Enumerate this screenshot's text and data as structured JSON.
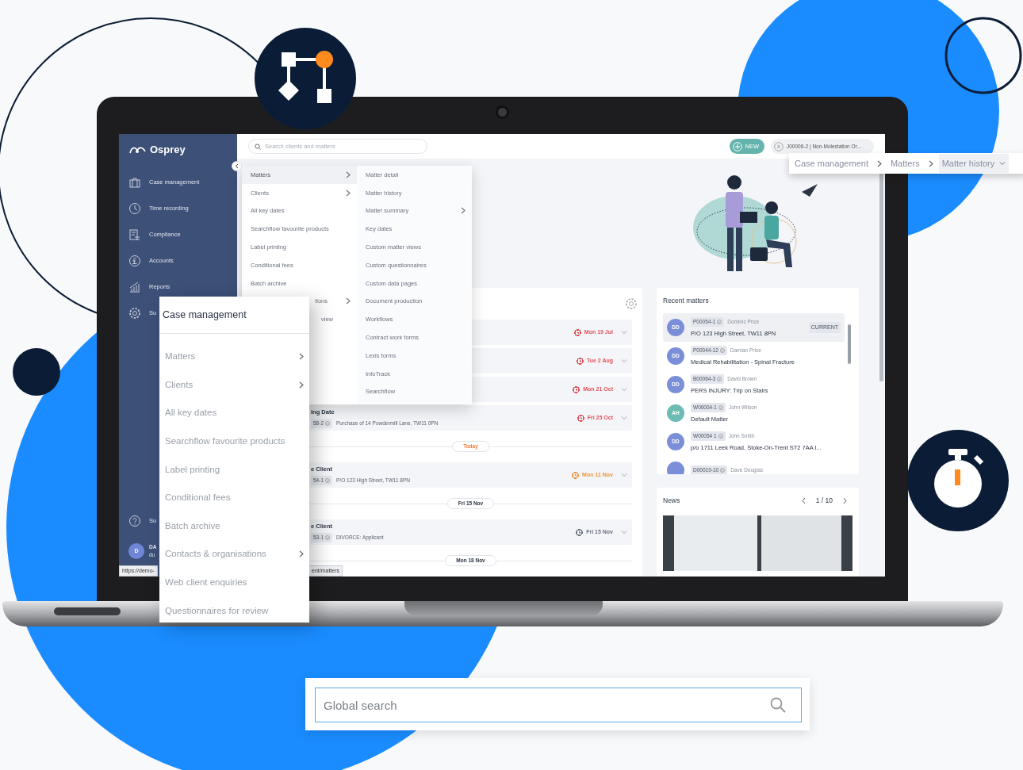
{
  "sidebar": {
    "logo": "Osprey",
    "items": [
      {
        "label": "Case management"
      },
      {
        "label": "Time recording"
      },
      {
        "label": "Compliance"
      },
      {
        "label": "Accounts"
      },
      {
        "label": "Reports"
      },
      {
        "label": "Su"
      }
    ],
    "help": "Su",
    "user": {
      "initials": "D",
      "name": "DA",
      "email": "du"
    }
  },
  "status_bar": [
    "https://demo-",
    "ent/matters"
  ],
  "topbar": {
    "search": {
      "placeholder": "Search clients and matters"
    },
    "new_button": "NEW",
    "recent_matter": "J00006-2 | Non-Molestation Or..."
  },
  "nav_menu": {
    "columns": [
      [
        {
          "label": "Matters",
          "submenu": true,
          "selected": true,
          "kind": "full"
        },
        {
          "label": "Clients",
          "submenu": true,
          "selected": false,
          "kind": "full"
        },
        {
          "label": "All key dates",
          "submenu": false,
          "selected": false,
          "kind": "full"
        },
        {
          "label": "Searchflow favourite products",
          "submenu": false,
          "selected": false,
          "kind": "full"
        },
        {
          "label": "Label printing",
          "submenu": false,
          "selected": false,
          "kind": "full"
        },
        {
          "label": "Conditional fees",
          "submenu": false,
          "selected": false,
          "kind": "full"
        },
        {
          "label": "Batch archive",
          "submenu": false,
          "selected": false,
          "kind": "full"
        },
        {
          "label": "tions",
          "submenu": true,
          "selected": false,
          "kind": "cut"
        },
        {
          "label": "view",
          "submenu": false,
          "selected": false,
          "kind": "cut"
        }
      ],
      [
        {
          "label": "Matter detail",
          "submenu": false,
          "selected": false,
          "kind": "full"
        },
        {
          "label": "Matter history",
          "submenu": false,
          "selected": false,
          "kind": "full"
        },
        {
          "label": "Matter summary",
          "submenu": true,
          "selected": false,
          "kind": "full"
        },
        {
          "label": "Key dates",
          "submenu": false,
          "selected": false,
          "kind": "full"
        },
        {
          "label": "Custom matter views",
          "submenu": false,
          "selected": false,
          "kind": "full"
        },
        {
          "label": "Custom questionnaires",
          "submenu": false,
          "selected": false,
          "kind": "full"
        },
        {
          "label": "Custom data pages",
          "submenu": false,
          "selected": false,
          "kind": "full"
        },
        {
          "label": "Document production",
          "submenu": false,
          "selected": false,
          "kind": "full"
        },
        {
          "label": "Workflows",
          "submenu": false,
          "selected": false,
          "kind": "full"
        },
        {
          "label": "Contract work forms",
          "submenu": false,
          "selected": false,
          "kind": "full"
        },
        {
          "label": "Lexis forms",
          "submenu": false,
          "selected": false,
          "kind": "full"
        },
        {
          "label": "InfoTrack",
          "submenu": false,
          "selected": false,
          "kind": "full"
        },
        {
          "label": "Searchflow",
          "submenu": false,
          "selected": false,
          "kind": "full"
        }
      ]
    ]
  },
  "key_dates": {
    "entries": [
      {
        "kind": "row",
        "date": "Mon 19 Jul",
        "color": "#e2525c"
      },
      {
        "kind": "row",
        "date": "Tue 2 Aug",
        "color": "#e2525c"
      },
      {
        "kind": "row",
        "date": "Mon 21 Oct",
        "color": "#e2525c"
      },
      {
        "kind": "row",
        "title": "ing Date",
        "ref": "58-2",
        "description": "Purchase of 14 Powdermill Lane, TW11 0PN",
        "date": "Fri 25 Oct",
        "color": "#e2525c"
      },
      {
        "kind": "divider",
        "label": "Today",
        "color": "#f07d3c"
      },
      {
        "kind": "row",
        "title": "e Client",
        "ref": "54-1",
        "description": "P/O 123 High Street, TW11 8PN",
        "date": "Mon 11 Nov",
        "color": "#f0943c"
      },
      {
        "kind": "divider",
        "label": "Fri 15 Nov",
        "color": "#2b3445"
      },
      {
        "kind": "row",
        "title": "e Client",
        "ref": "53-1",
        "description": "DIVORCE: Applicant",
        "date": "Fri 15 Nov",
        "color": "#6b7280"
      },
      {
        "kind": "divider",
        "label": "Mon 18 Nov",
        "color": "#2b3445"
      }
    ]
  },
  "recent_matters": {
    "title": "Recent matters",
    "items": [
      {
        "initials": "DD",
        "color": "#7b8ed8",
        "ref": "P00054-1",
        "client": "Dominic Price",
        "title": "P/O 123 High Street, TW11 8PN",
        "badge": "CURRENT",
        "selected": true
      },
      {
        "initials": "DD",
        "color": "#7b8ed8",
        "ref": "P00044-12",
        "client": "Damian Price",
        "title": "Medical Rehabilitation - Spinal Fracture",
        "selected": false
      },
      {
        "initials": "DD",
        "color": "#7b8ed8",
        "ref": "B00064-3",
        "client": "David Brown",
        "title": "PERS INJURY: Trip on Stairs",
        "selected": false
      },
      {
        "initials": "AH",
        "color": "#6bbcb3",
        "ref": "W00004-1",
        "client": "John Wilson",
        "title": "Default Matter",
        "selected": false
      },
      {
        "initials": "DD",
        "color": "#7b8ed8",
        "ref": "W00054 1",
        "client": "John Smith",
        "title": "p/o 1711 Leek Road, Stoke-On-Trent ST2 7AA I...",
        "selected": false
      },
      {
        "color": "#7b8ed8",
        "ref": "D00019-10",
        "client": "Dave Douglas",
        "selected": false
      }
    ]
  },
  "news": {
    "title": "News",
    "pager": "1 / 10"
  },
  "case_menu": {
    "title": "Case management",
    "items": [
      {
        "label": "Matters",
        "submenu": true
      },
      {
        "label": "Clients",
        "submenu": true
      },
      {
        "label": "All key dates",
        "submenu": false
      },
      {
        "label": "Searchflow favourite products",
        "submenu": false
      },
      {
        "label": "Label printing",
        "submenu": false
      },
      {
        "label": "Conditional fees",
        "submenu": false
      },
      {
        "label": "Batch archive",
        "submenu": false
      },
      {
        "label": "Contacts & organisations",
        "submenu": true
      },
      {
        "label": "Web client enquiries",
        "submenu": false
      },
      {
        "label": "Questionnaires for review",
        "submenu": false
      }
    ]
  },
  "breadcrumb": [
    {
      "label": "Case management",
      "selected": false
    },
    {
      "label": "Matters",
      "selected": false
    },
    {
      "label": "Matter history",
      "selected": true
    }
  ],
  "global_search": {
    "placeholder": "Global search"
  }
}
